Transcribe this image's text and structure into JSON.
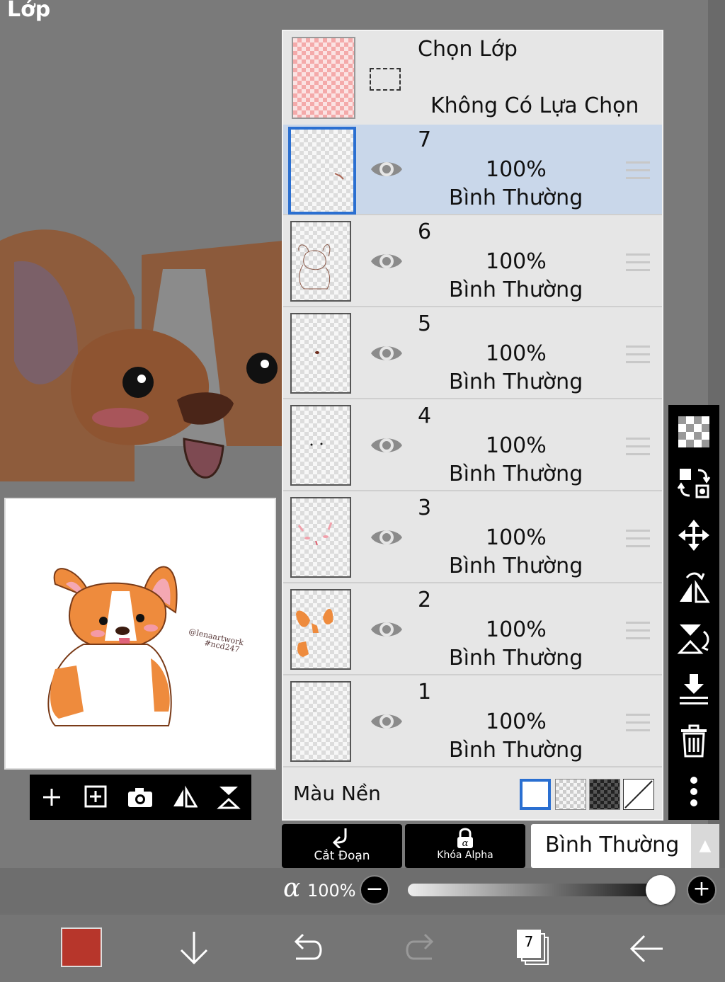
{
  "screen_title": "Lớp",
  "selection": {
    "title": "Chọn Lớp",
    "subtitle": "Không Có Lựa Chọn"
  },
  "layers": [
    {
      "number": "7",
      "opacity": "100%",
      "mode": "Bình Thường",
      "active": true
    },
    {
      "number": "6",
      "opacity": "100%",
      "mode": "Bình Thường",
      "active": false
    },
    {
      "number": "5",
      "opacity": "100%",
      "mode": "Bình Thường",
      "active": false
    },
    {
      "number": "4",
      "opacity": "100%",
      "mode": "Bình Thường",
      "active": false
    },
    {
      "number": "3",
      "opacity": "100%",
      "mode": "Bình Thường",
      "active": false
    },
    {
      "number": "2",
      "opacity": "100%",
      "mode": "Bình Thường",
      "active": false
    },
    {
      "number": "1",
      "opacity": "100%",
      "mode": "Bình Thường",
      "active": false
    }
  ],
  "background": {
    "label": "Màu Nền"
  },
  "buttons": {
    "clip": "Cắt Đoạn",
    "alpha_lock": "Khóa Alpha"
  },
  "blend_mode": {
    "value": "Bình Thường",
    "arrow": "▲"
  },
  "alpha": {
    "symbol": "α",
    "value": "100%",
    "level": 1.0
  },
  "bottom_bar": {
    "layer_count": "7",
    "color": "#b7362b"
  },
  "colors": {
    "accent": "#2a6fd1",
    "active_row": "#c9d7ea",
    "toolbar": "#000000"
  }
}
